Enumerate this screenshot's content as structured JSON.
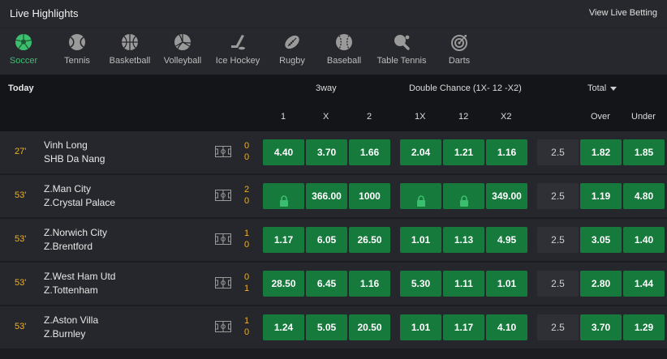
{
  "header": {
    "title": "Live  Highlights",
    "view_link": "View Live Betting"
  },
  "sports": [
    {
      "label": "Soccer",
      "icon": "soccer-ball-icon",
      "active": true
    },
    {
      "label": "Tennis",
      "icon": "tennis-ball-icon",
      "active": false
    },
    {
      "label": "Basketball",
      "icon": "basketball-icon",
      "active": false
    },
    {
      "label": "Volleyball",
      "icon": "volleyball-icon",
      "active": false
    },
    {
      "label": "Ice Hockey",
      "icon": "ice-hockey-icon",
      "active": false
    },
    {
      "label": "Rugby",
      "icon": "rugby-ball-icon",
      "active": false
    },
    {
      "label": "Baseball",
      "icon": "baseball-icon",
      "active": false
    },
    {
      "label": "Table Tennis",
      "icon": "table-tennis-icon",
      "active": false
    },
    {
      "label": "Darts",
      "icon": "darts-icon",
      "active": false
    }
  ],
  "table": {
    "day": "Today",
    "group_3way": "3way",
    "group_double": "Double Chance (1X- 12 -X2)",
    "group_total": "Total",
    "cols": {
      "c1": "1",
      "cx": "X",
      "c2": "2",
      "d1x": "1X",
      "d12": "12",
      "dx2": "X2",
      "over": "Over",
      "under": "Under"
    }
  },
  "matches": [
    {
      "minute": "27'",
      "home": "Vinh Long",
      "away": "SHB Da Nang",
      "home_score": "0",
      "away_score": "0",
      "odds": [
        "4.40",
        "3.70",
        "1.66",
        "2.04",
        "1.21",
        "1.16"
      ],
      "line": "2.5",
      "over": "1.82",
      "under": "1.85"
    },
    {
      "minute": "53'",
      "home": "Z.Man City",
      "away": "Z.Crystal Palace",
      "home_score": "2",
      "away_score": "0",
      "odds": [
        "locked",
        "366.00",
        "1000",
        "locked",
        "locked",
        "349.00"
      ],
      "line": "2.5",
      "over": "1.19",
      "under": "4.80"
    },
    {
      "minute": "53'",
      "home": "Z.Norwich City",
      "away": "Z.Brentford",
      "home_score": "1",
      "away_score": "0",
      "odds": [
        "1.17",
        "6.05",
        "26.50",
        "1.01",
        "1.13",
        "4.95"
      ],
      "line": "2.5",
      "over": "3.05",
      "under": "1.40"
    },
    {
      "minute": "53'",
      "home": "Z.West Ham Utd",
      "away": "Z.Tottenham",
      "home_score": "0",
      "away_score": "1",
      "odds": [
        "28.50",
        "6.45",
        "1.16",
        "5.30",
        "1.11",
        "1.01"
      ],
      "line": "2.5",
      "over": "2.80",
      "under": "1.44"
    },
    {
      "minute": "53'",
      "home": "Z.Aston Villa",
      "away": "Z.Burnley",
      "home_score": "1",
      "away_score": "0",
      "odds": [
        "1.24",
        "5.05",
        "20.50",
        "1.01",
        "1.17",
        "4.10"
      ],
      "line": "2.5",
      "over": "3.70",
      "under": "1.29"
    }
  ],
  "colors": {
    "odd_bg": "#157a3c",
    "accent_green": "#3cbe6f",
    "minute": "#f0b020",
    "line_bg": "#2f3036"
  }
}
